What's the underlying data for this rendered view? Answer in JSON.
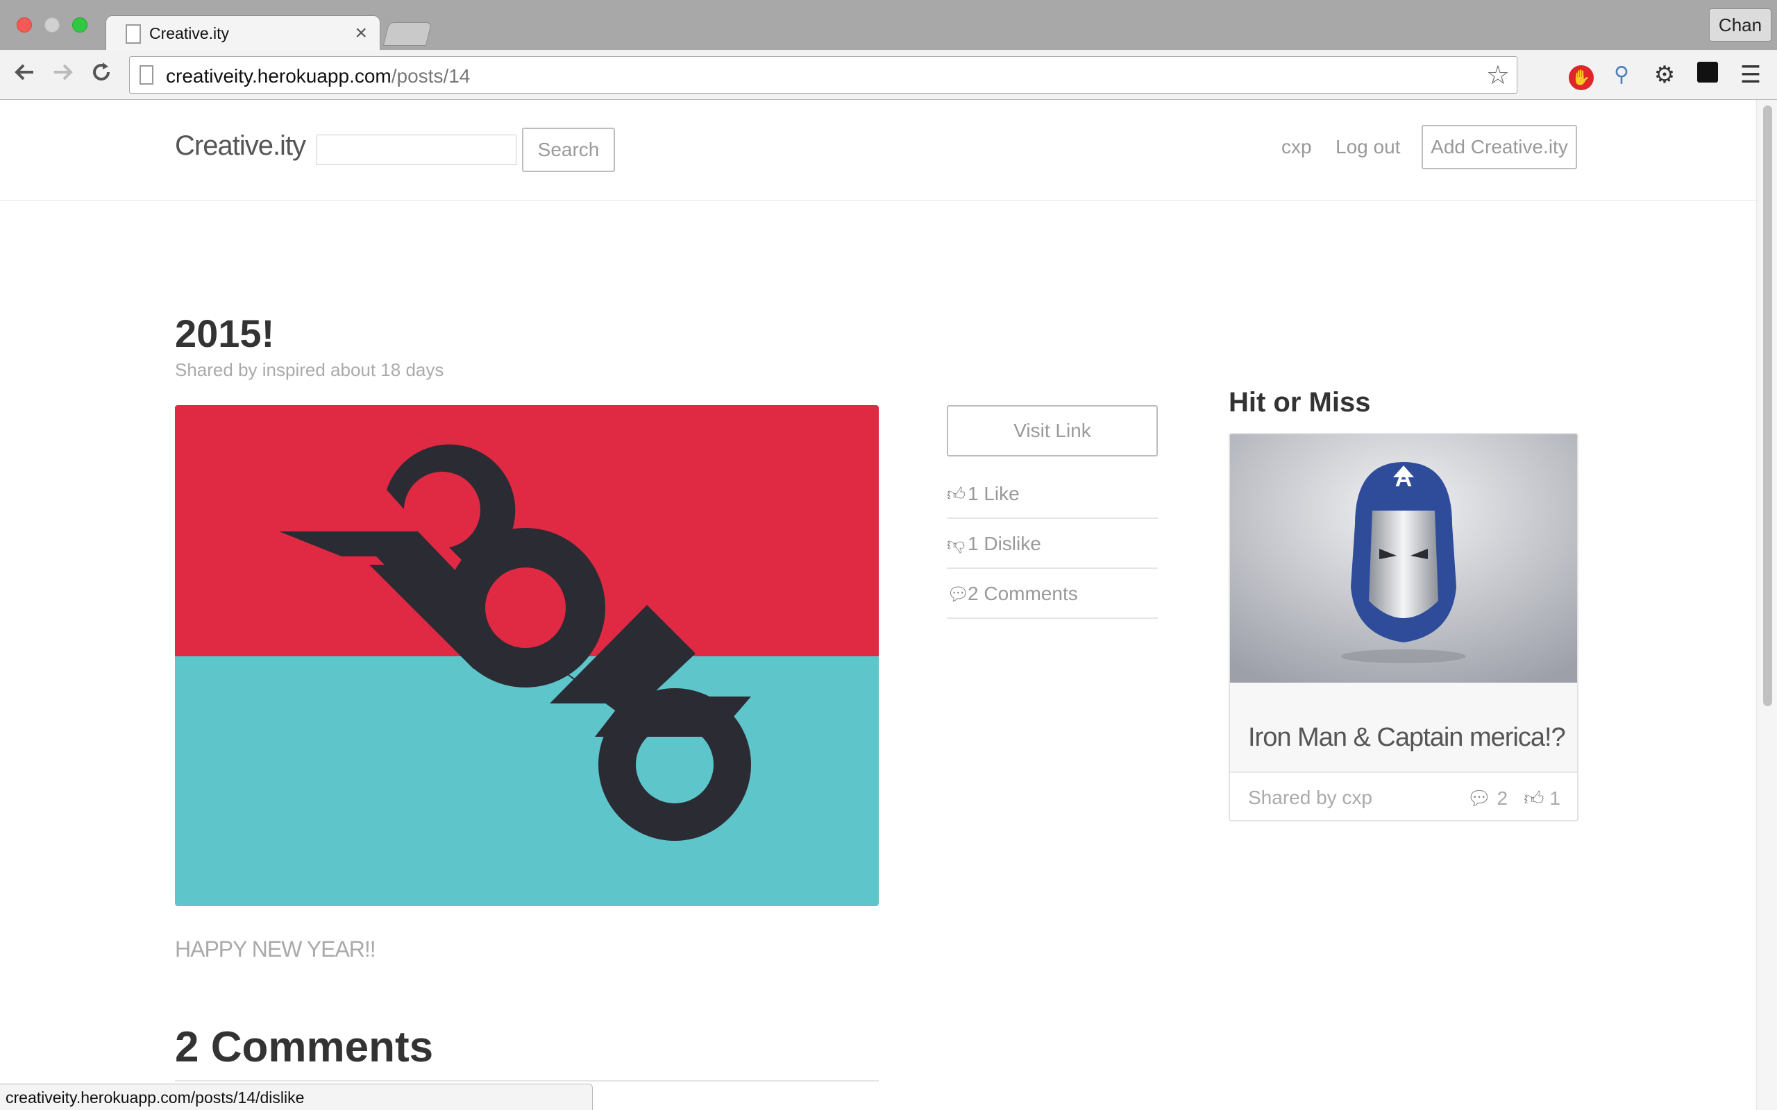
{
  "browser": {
    "tab_title": "Creative.ity",
    "tab_close": "×",
    "profile_name": "Chan",
    "url_host": "creativeity.herokuapp.com",
    "url_path": "/posts/14",
    "status_url": "creativeity.herokuapp.com/posts/14/dislike"
  },
  "site": {
    "brand": "Creative.ity",
    "search_button": "Search",
    "search_placeholder": "",
    "user": "cxp",
    "logout": "Log out",
    "add_button": "Add Creative.ity"
  },
  "post": {
    "title": "2015!",
    "meta": "Shared by inspired about 18 days",
    "description": "HAPPY NEW YEAR!!",
    "visit_link": "Visit Link",
    "likes": "1 Like",
    "dislikes": "1 Dislike",
    "comments": "2 Comments",
    "image_colors": {
      "top": "#e02a44",
      "bottom": "#5ec5cb",
      "figure": "#2a2b33"
    }
  },
  "comments_section": {
    "heading": "2 Comments"
  },
  "sidebar": {
    "heading": "Hit or Miss",
    "card": {
      "title": "Iron Man & Captain merica!?",
      "shared_by": "Shared by cxp",
      "comment_count": "2",
      "like_count": "1"
    }
  },
  "icons": {
    "back": "arrow-left-icon",
    "forward": "arrow-right-icon",
    "reload": "reload-icon",
    "star": "star-icon",
    "like": "thumbs-up-icon",
    "dislike": "thumbs-down-icon",
    "comments": "comments-icon"
  }
}
